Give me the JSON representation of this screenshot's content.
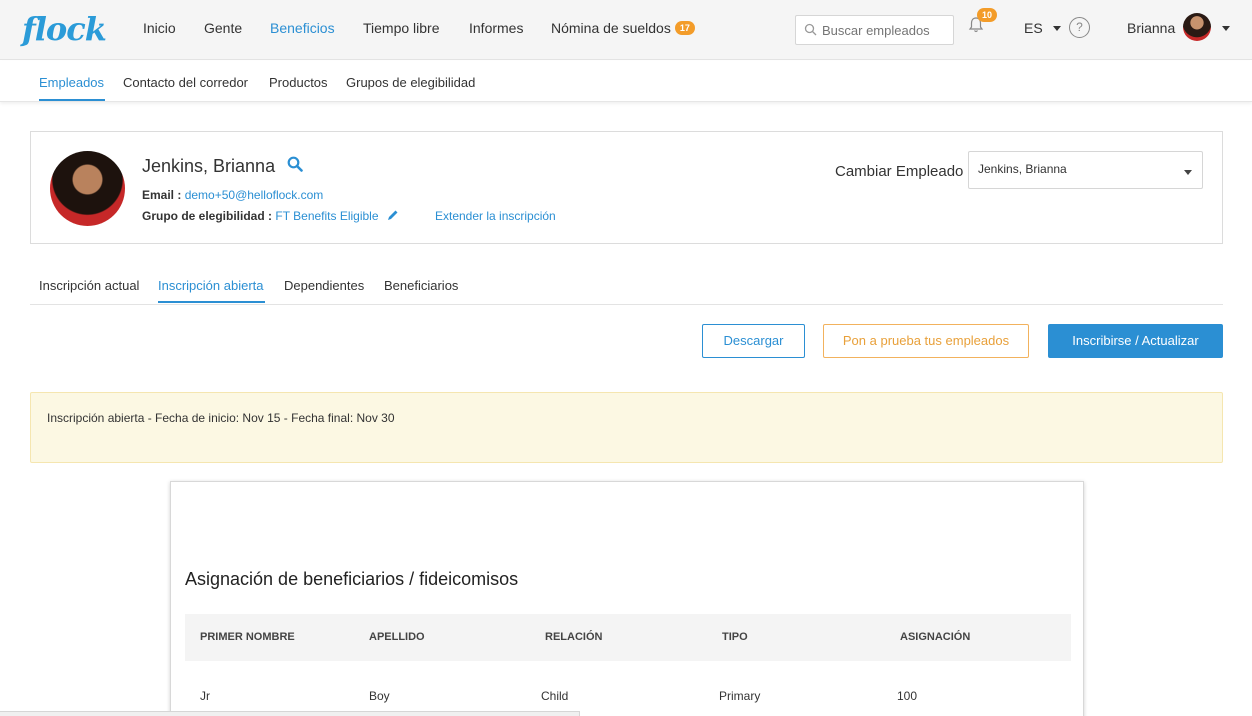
{
  "topnav": {
    "logo": "flock",
    "items": [
      {
        "label": "Inicio"
      },
      {
        "label": "Gente"
      },
      {
        "label": "Beneficios"
      },
      {
        "label": "Tiempo libre"
      },
      {
        "label": "Informes"
      },
      {
        "label": "Nómina de sueldos",
        "badge": "17"
      }
    ],
    "search_placeholder": "Buscar empleados",
    "notification_count": "10",
    "language": "ES",
    "help": "?",
    "user_name": "Brianna"
  },
  "subnav": {
    "items": [
      {
        "label": "Empleados"
      },
      {
        "label": "Contacto del corredor"
      },
      {
        "label": "Productos"
      },
      {
        "label": "Grupos de elegibilidad"
      }
    ]
  },
  "employee": {
    "name": "Jenkins, Brianna",
    "email_label": "Email :",
    "email": "demo+50@helloflock.com",
    "group_label": "Grupo de elegibilidad :",
    "group": "FT Benefits Eligible",
    "extend_link": "Extender la inscripción",
    "change_label": "Cambiar Empleado",
    "selected": "Jenkins, Brianna"
  },
  "tabs": [
    {
      "label": "Inscripción actual"
    },
    {
      "label": "Inscripción abierta"
    },
    {
      "label": "Dependientes"
    },
    {
      "label": "Beneficiarios"
    }
  ],
  "actions": {
    "download": "Descargar",
    "test": "Pon a prueba tus empleados",
    "enroll": "Inscribirse / Actualizar"
  },
  "notice": "Inscripción abierta - Fecha de inicio: Nov 15 - Fecha final: Nov 30",
  "allocation": {
    "title": "Asignación de beneficiarios / fideicomisos",
    "columns": [
      "PRIMER NOMBRE",
      "APELLIDO",
      "RELACIÓN",
      "TIPO",
      "ASIGNACIÓN"
    ],
    "rows": [
      [
        "Jr",
        "Boy",
        "Child",
        "Primary",
        "100"
      ]
    ]
  },
  "colors": {
    "accent": "#2b8fd3",
    "badge": "#f39c29",
    "notice_bg": "#fcf8e3",
    "test_button": "#e8a03a"
  },
  "icons": [
    "search-icon",
    "bell-icon",
    "help-icon",
    "pencil-icon",
    "chevron-down-icon"
  ]
}
